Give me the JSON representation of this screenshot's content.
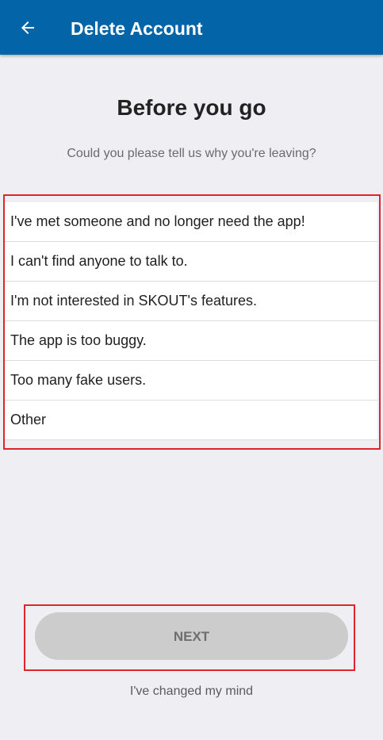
{
  "app_bar": {
    "title": "Delete Account",
    "back_icon": "arrow-left-icon",
    "color": "#0364a8"
  },
  "main": {
    "heading": "Before you go",
    "subheading": "Could you please tell us why you're leaving?",
    "reasons": [
      {
        "label": "I've met someone and no longer need the app!"
      },
      {
        "label": "I can't find anyone to talk to."
      },
      {
        "label": "I'm not interested in SKOUT's features."
      },
      {
        "label": "The app is too buggy."
      },
      {
        "label": "Too many fake users."
      },
      {
        "label": "Other"
      }
    ]
  },
  "footer": {
    "next_label": "NEXT",
    "changed_mind_label": "I've changed my mind"
  },
  "highlight_color": "#e0242c"
}
